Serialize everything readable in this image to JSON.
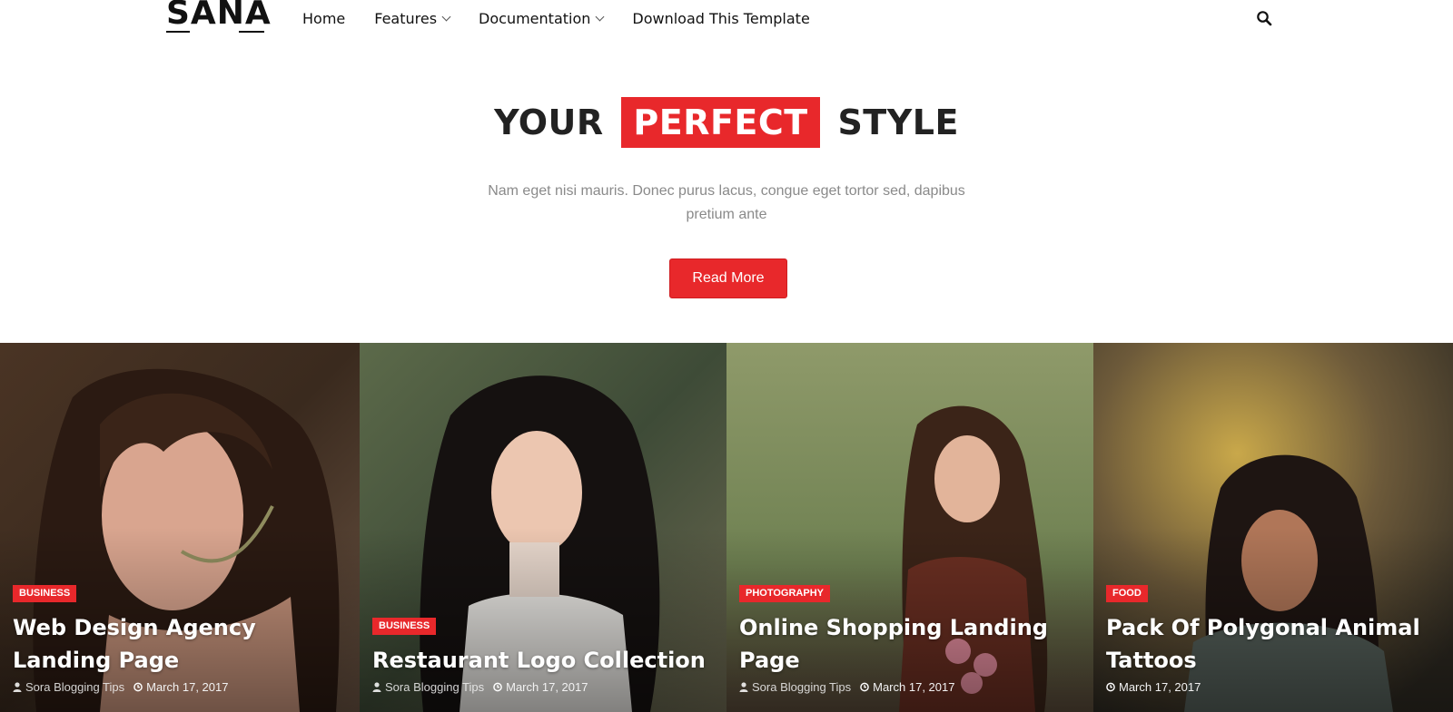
{
  "nav": {
    "logo": "SANA",
    "menu": [
      {
        "label": "Home",
        "dropdown": false
      },
      {
        "label": "Features",
        "dropdown": true
      },
      {
        "label": "Documentation",
        "dropdown": true
      },
      {
        "label": "Download This Template",
        "dropdown": false
      }
    ],
    "search_icon": "search-icon"
  },
  "hero": {
    "title_before": "YOUR",
    "title_highlight": "PERFECT",
    "title_after": "STYLE",
    "subtitle": "Nam eget nisi mauris. Donec purus lacus, congue eget tortor sed, dapibus pretium ante",
    "button": "Read More"
  },
  "colors": {
    "accent": "#e8282b",
    "text": "#222222",
    "muted": "#8a8a8a"
  },
  "featured": [
    {
      "category": "BUSINESS",
      "title": "Web Design Agency Landing Page",
      "author": "Sora Blogging Tips",
      "date": "March 17, 2017"
    },
    {
      "category": "BUSINESS",
      "title": "Restaurant Logo Collection",
      "author": "Sora Blogging Tips",
      "date": "March 17, 2017"
    },
    {
      "category": "PHOTOGRAPHY",
      "title": "Online Shopping Landing Page",
      "author": "Sora Blogging Tips",
      "date": "March 17, 2017"
    },
    {
      "category": "FOOD",
      "title": "Pack Of Polygonal Animal Tattoos",
      "author": "",
      "date": "March 17, 2017"
    }
  ]
}
